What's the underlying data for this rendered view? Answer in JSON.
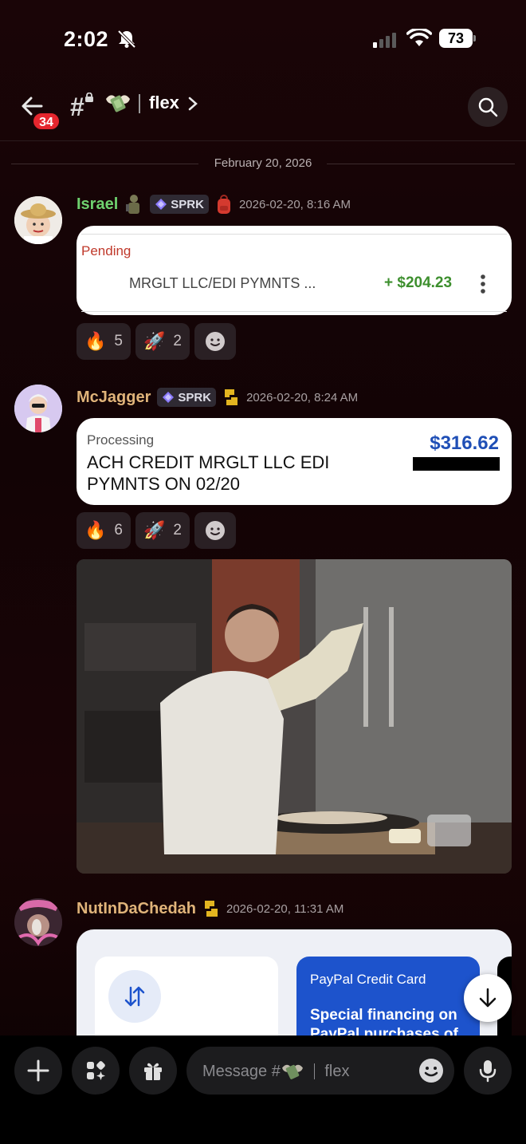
{
  "status": {
    "time": "2:02",
    "battery": "73"
  },
  "header": {
    "back_badge": "34",
    "channel_name": "flex"
  },
  "date_divider": "February 20, 2026",
  "messages": [
    {
      "username": "Israel",
      "username_color": "#6fd26f",
      "tag": "SPRK",
      "timestamp": "2026-02-20, 8:16 AM",
      "card": {
        "status": "Pending",
        "description": "MRGLT LLC/EDI PYMNTS ...",
        "amount": "+ $204.23"
      },
      "reactions": [
        {
          "emoji": "🔥",
          "count": "5"
        },
        {
          "emoji": "🚀",
          "count": "2"
        }
      ]
    },
    {
      "username": "McJagger",
      "username_color": "#e0b47a",
      "tag": "SPRK",
      "timestamp": "2026-02-20, 8:24 AM",
      "card": {
        "status": "Processing",
        "description": "ACH CREDIT MRGLT LLC EDI PYMNTS ON 02/20",
        "amount": "$316.62"
      },
      "reactions": [
        {
          "emoji": "🔥",
          "count": "6"
        },
        {
          "emoji": "🚀",
          "count": "2"
        }
      ]
    },
    {
      "username": "NutInDaChedah",
      "username_color": "#e0b47a",
      "timestamp": "2026-02-20, 11:31 AM",
      "card": {
        "promo_title": "PayPal Credit Card",
        "promo_text": "Special financing on PayPal purchases of"
      }
    }
  ],
  "composer": {
    "placeholder_prefix": "Message #",
    "placeholder_channel": "flex"
  },
  "colors": {
    "pending_red": "#c0392b",
    "amount_green": "#3d8f2e",
    "amount_blue": "#1f4fb6",
    "paypal_blue": "#1d53cc"
  }
}
